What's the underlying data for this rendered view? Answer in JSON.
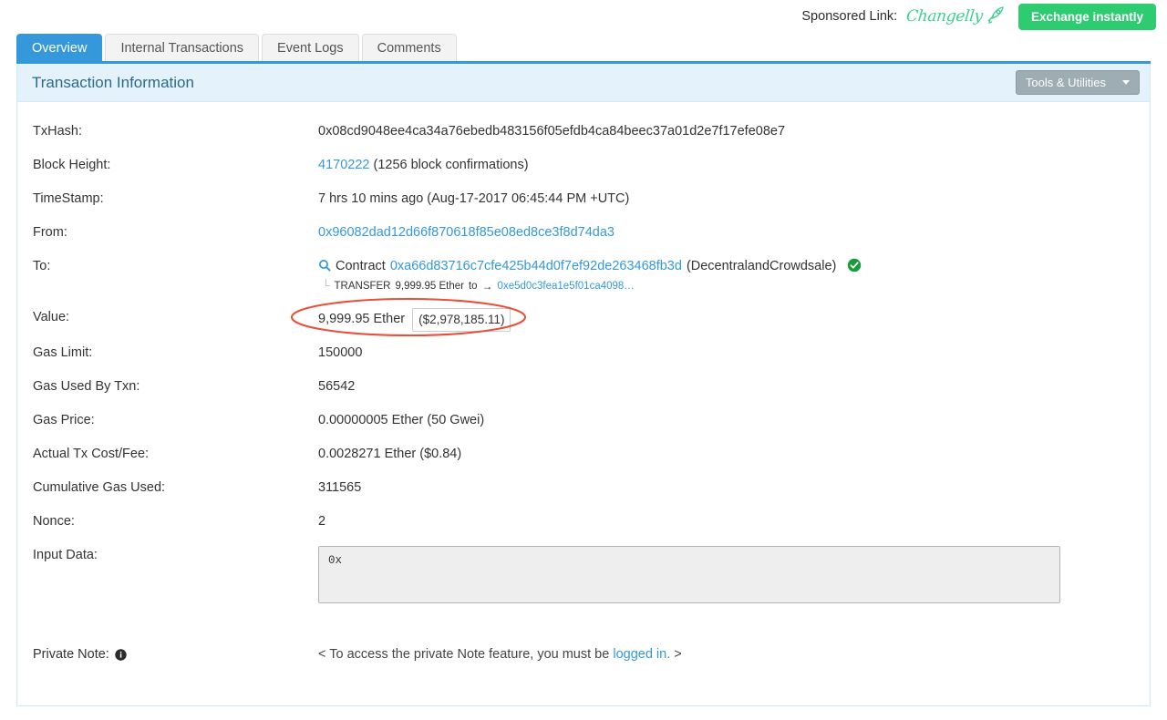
{
  "sponsor": {
    "label": "Sponsored Link:",
    "brand": "Changelly",
    "brand_icon": "rocket-icon",
    "button": "Exchange instantly",
    "button_color": "#2ecc71",
    "brand_color": "#3ecf8e"
  },
  "tabs": [
    {
      "label": "Overview",
      "active": true
    },
    {
      "label": "Internal Transactions",
      "active": false
    },
    {
      "label": "Event Logs",
      "active": false
    },
    {
      "label": "Comments",
      "active": false
    }
  ],
  "card": {
    "title": "Transaction Information",
    "tools_button": "Tools & Utilities",
    "accent_color": "#3498db",
    "header_bg": "#e3f2fb"
  },
  "transaction": {
    "txhash": {
      "label": "TxHash:",
      "value": "0x08cd9048ee4ca34a76ebedb483156f05efdb4ca84beec37a01d2e7f17efe08e7"
    },
    "block_height": {
      "label": "Block Height:",
      "value": "4170222",
      "confirmations": "(1256 block confirmations)"
    },
    "timestamp": {
      "label": "TimeStamp:",
      "value": "7 hrs 10 mins ago (Aug-17-2017 06:45:44 PM +UTC)"
    },
    "from": {
      "label": "From:",
      "value": "0x96082dad12d66f870618f85e08ed8ce3f8d74da3"
    },
    "to": {
      "label": "To:",
      "prefix": "Contract",
      "address": "0xa66d83716c7cfe425b44d0f7ef92de263468fb3d",
      "contract_name": "(DecentralandCrowdsale)",
      "verified_icon": "check-circle-icon",
      "search_icon": "magnifier-icon",
      "transfer": {
        "label": "TRANSFER",
        "amount": "9,999.95 Ether",
        "to_word": "to",
        "arrow": "→",
        "address": "0xe5d0c3fea1e5f01ca4098…"
      }
    },
    "value": {
      "label": "Value:",
      "ether": "9,999.95 Ether",
      "usd": "($2,978,185.11)",
      "annotation": "red-ellipse-highlight",
      "annotation_color": "#e8503a"
    },
    "gas_limit": {
      "label": "Gas Limit:",
      "value": "150000"
    },
    "gas_used": {
      "label": "Gas Used By Txn:",
      "value": "56542"
    },
    "gas_price": {
      "label": "Gas Price:",
      "value": "0.00000005 Ether (50 Gwei)"
    },
    "tx_fee": {
      "label": "Actual Tx Cost/Fee:",
      "value": "0.0028271 Ether ($0.84)"
    },
    "cumulative_gas": {
      "label": "Cumulative Gas Used:",
      "value": "311565"
    },
    "nonce": {
      "label": "Nonce:",
      "value": "2"
    },
    "input_data": {
      "label": "Input Data:",
      "value": "0x"
    },
    "private_note": {
      "label": "Private Note:",
      "info_icon": "info-icon",
      "text_before": "< To access the private Note feature, you must be",
      "link": "logged in.",
      "text_after": ">"
    }
  }
}
